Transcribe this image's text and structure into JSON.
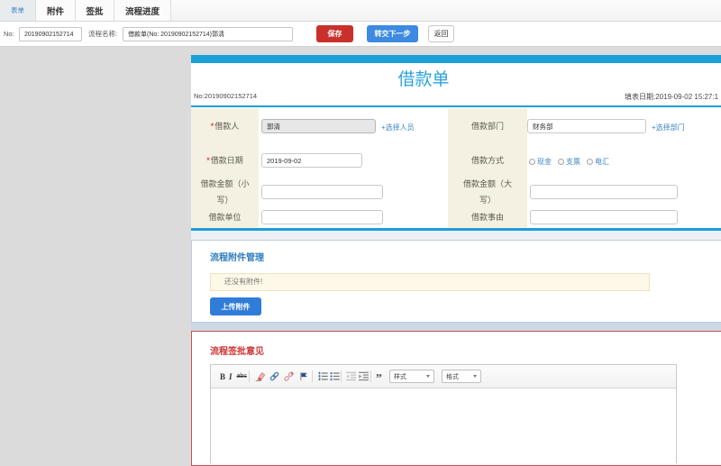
{
  "tabs": {
    "items": [
      {
        "label": "表单",
        "active": true
      },
      {
        "label": "附件",
        "active": false
      },
      {
        "label": "签批",
        "active": false
      },
      {
        "label": "流程进度",
        "active": false
      }
    ]
  },
  "cmdbar": {
    "no_label": "No:",
    "no_value": "20190902152714",
    "name_label": "流程名称:",
    "name_value": "借款单(No: 20190902152714)郭清",
    "save_label": "保存",
    "next_label": "转交下一步",
    "back_label": "返回"
  },
  "form": {
    "title": "借款单",
    "no_text": "No:20190902152714",
    "date_text": "填表日期:2019-09-02 15:27:1",
    "req_mark": "*",
    "rows": [
      {
        "left": {
          "label": "借款人",
          "value": "郭清",
          "link": "+选择人员"
        },
        "right": {
          "label": "借款部门",
          "value": "财务部",
          "link": "+选择部门"
        }
      },
      {
        "left": {
          "label": "借款日期",
          "value": "2019-09-02"
        },
        "right": {
          "label": "借款方式",
          "options": [
            "现金",
            "支票",
            "电汇"
          ]
        }
      },
      {
        "left": {
          "label": "借款金额（小写）",
          "value": ""
        },
        "right": {
          "label": "借款金额（大写）",
          "value": ""
        }
      },
      {
        "left": {
          "label": "借款单位",
          "value": ""
        },
        "right": {
          "label": "借款事由",
          "value": ""
        }
      }
    ]
  },
  "attachments": {
    "title": "流程附件管理",
    "empty_text": "还没有附件!",
    "upload_label": "上传附件"
  },
  "approval": {
    "title": "流程签批意见",
    "toolbar": {
      "bold": "B",
      "italic": "I",
      "strike": "abc",
      "quote": "”",
      "style_dropdown": "样式",
      "format_dropdown": "格式"
    }
  },
  "colors": {
    "accent_blue": "#1a9fd9",
    "title_blue": "#2ba4da",
    "link_blue": "#3d85c6",
    "save_red": "#c9302c",
    "next_blue": "#3d8ae0",
    "upload_blue": "#2f7cd9",
    "label_bg": "#f4f1e3",
    "section_red": "#ca3633",
    "section_blue": "#2e7ebe"
  }
}
